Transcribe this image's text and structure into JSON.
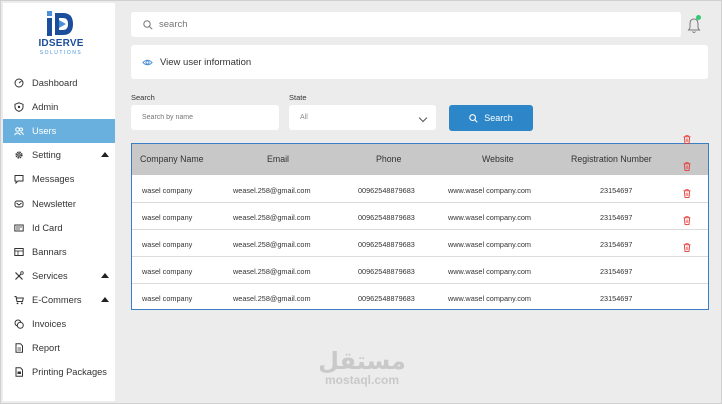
{
  "brand": {
    "name": "IDSERVE",
    "tagline": "SOLUTIONS",
    "mark": "iD"
  },
  "sidebar": {
    "items": [
      {
        "label": "Dashboard",
        "icon": "dashboard-icon",
        "active": false,
        "expandable": false
      },
      {
        "label": "Admin",
        "icon": "shield-icon",
        "active": false,
        "expandable": false
      },
      {
        "label": "Users",
        "icon": "users-icon",
        "active": true,
        "expandable": false
      },
      {
        "label": "Setting",
        "icon": "gear-icon",
        "active": false,
        "expandable": true
      },
      {
        "label": "Messages",
        "icon": "chat-icon",
        "active": false,
        "expandable": false
      },
      {
        "label": "Newsletter",
        "icon": "mail-icon",
        "active": false,
        "expandable": false
      },
      {
        "label": "Id Card",
        "icon": "id-card-icon",
        "active": false,
        "expandable": false
      },
      {
        "label": "Bannars",
        "icon": "banner-icon",
        "active": false,
        "expandable": false
      },
      {
        "label": "Services",
        "icon": "tools-icon",
        "active": false,
        "expandable": true
      },
      {
        "label": "E-Commers",
        "icon": "cart-icon",
        "active": false,
        "expandable": true
      },
      {
        "label": "Invoices",
        "icon": "coins-icon",
        "active": false,
        "expandable": false
      },
      {
        "label": "Report",
        "icon": "report-icon",
        "active": false,
        "expandable": false
      },
      {
        "label": "Printing Packages",
        "icon": "print-icon",
        "active": false,
        "expandable": false
      }
    ]
  },
  "topbar": {
    "search_placeholder": "search"
  },
  "info": {
    "label": "View user information"
  },
  "filters": {
    "search_label": "Search",
    "search_placeholder": "Search by name",
    "state_label": "State",
    "state_value": "All",
    "button_label": "Search"
  },
  "table": {
    "columns": [
      "Company Name",
      "Email",
      "Phone",
      "Website",
      "Registration Number"
    ],
    "rows": [
      {
        "company": "wasel company",
        "email": "weasel.258@gmail.com",
        "phone": "00962548879683",
        "website": "www.wasel company.com",
        "reg": "23154697",
        "delete": true
      },
      {
        "company": "wasel company",
        "email": "weasel.258@gmail.com",
        "phone": "00962548879683",
        "website": "www.wasel company.com",
        "reg": "23154697",
        "delete": true
      },
      {
        "company": "wasel company",
        "email": "weasel.258@gmail.com",
        "phone": "00962548879683",
        "website": "www.wasel company.com",
        "reg": "23154697",
        "delete": true
      },
      {
        "company": "wasel company",
        "email": "weasel.258@gmail.com",
        "phone": "00962548879683",
        "website": "www.wasel company.com",
        "reg": "23154697",
        "delete": false
      },
      {
        "company": "wasel company",
        "email": "weasel.258@gmail.com",
        "phone": "00962548879683",
        "website": "www.wasel company.com",
        "reg": "23154697",
        "delete": false
      }
    ]
  },
  "watermark": {
    "arabic": "مستقل",
    "latin": "mostaql.com"
  },
  "colors": {
    "accent": "#2c86c8",
    "active_nav": "#6ab0de",
    "table_border": "#3a7ec4",
    "header_bg": "#c8c8c8",
    "delete": "#e53935",
    "status_dot": "#2ecc71"
  }
}
